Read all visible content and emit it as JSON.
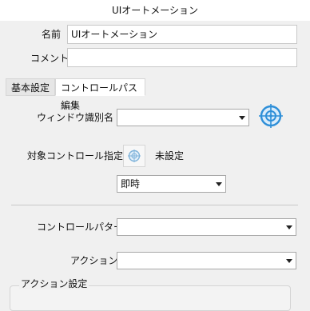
{
  "window": {
    "title": "UIオートメーション"
  },
  "form": {
    "name_label": "名前",
    "name_value": "UIオートメーション",
    "comment_label": "コメント",
    "comment_value": ""
  },
  "tabs": [
    {
      "label": "基本設定",
      "active": false
    },
    {
      "label": "コントロールパス編集",
      "active": true
    }
  ],
  "basic": {
    "window_id_label": "ウィンドウ識別名",
    "window_id_value": "",
    "target_label": "対象コントロール指定",
    "target_status": "未設定",
    "timing_value": "即時",
    "control_pattern_label": "コントロールパターン",
    "control_pattern_value": "",
    "action_label": "アクション",
    "action_value": "",
    "action_settings_label": "アクション設定"
  },
  "icons": {
    "window_picker": "crosshair-target-icon",
    "control_picker": "crosshair-target-icon",
    "dropdown": "chevron-down-icon"
  },
  "colors": {
    "accent": "#2f8fd8",
    "background": "#f0f0f0"
  }
}
